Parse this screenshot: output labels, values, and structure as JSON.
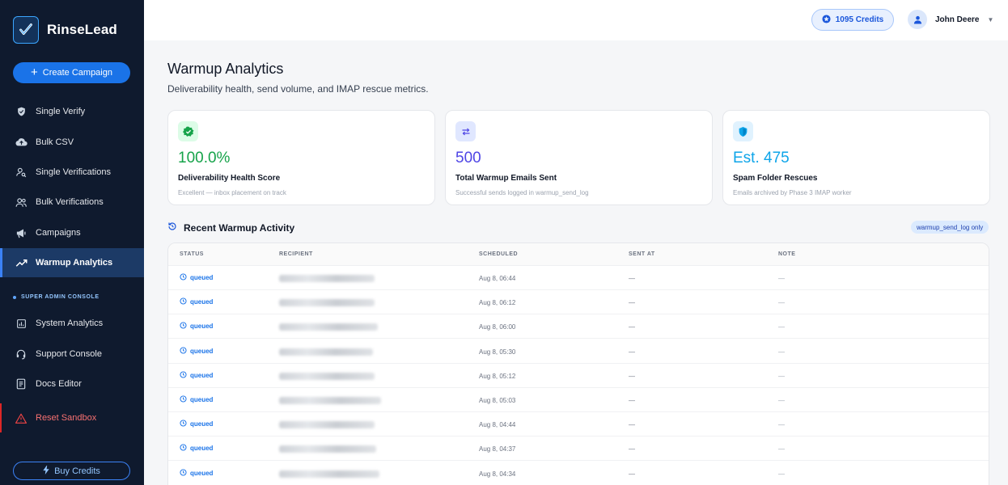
{
  "brand": {
    "name": "RinseLead"
  },
  "sidebar": {
    "create_label": "Create Campaign",
    "items": [
      {
        "label": "Single Verify",
        "icon": "shield-icon"
      },
      {
        "label": "Bulk CSV",
        "icon": "cloud-upload-icon"
      },
      {
        "label": "Single Verifications",
        "icon": "person-search-icon"
      },
      {
        "label": "Bulk Verifications",
        "icon": "group-icon"
      },
      {
        "label": "Campaigns",
        "icon": "megaphone-icon"
      },
      {
        "label": "Warmup Analytics",
        "icon": "trending-up-icon",
        "active": true
      }
    ],
    "section_label": "SUPER ADMIN CONSOLE",
    "admin_items": [
      {
        "label": "System Analytics",
        "icon": "bar-chart-icon"
      },
      {
        "label": "Support Console",
        "icon": "headset-icon"
      },
      {
        "label": "Docs Editor",
        "icon": "document-icon"
      }
    ],
    "reset_label": "Reset Sandbox",
    "buy_label": "Buy Credits"
  },
  "topbar": {
    "credits": "1095 Credits",
    "user_name": "John Deere"
  },
  "page": {
    "title": "Warmup Analytics",
    "subtitle": "Deliverability health, send volume, and IMAP rescue metrics."
  },
  "metrics": [
    {
      "value": "100.0%",
      "label": "Deliverability Health Score",
      "hint": "Excellent — inbox placement on track",
      "icon": "check-badge-icon",
      "color": "#16a34a"
    },
    {
      "value": "500",
      "label": "Total Warmup Emails Sent",
      "hint": "Successful sends logged in warmup_send_log",
      "icon": "swap-arrows-icon",
      "color": "#4f46e5"
    },
    {
      "value": "Est. 475",
      "label": "Spam Folder Rescues",
      "hint": "Emails archived by Phase 3 IMAP worker",
      "icon": "shield-check-icon",
      "color": "#0ea5e9"
    }
  ],
  "activity": {
    "title": "Recent Warmup Activity",
    "badge": "warmup_send_log only",
    "columns": [
      "STATUS",
      "RECIPIENT",
      "SCHEDULED",
      "SENT AT",
      "NOTE"
    ],
    "rows": [
      {
        "status": "queued",
        "scheduled": "Aug 8, 06:44",
        "sent_at": "—",
        "note": "—"
      },
      {
        "status": "queued",
        "scheduled": "Aug 8, 06:12",
        "sent_at": "—",
        "note": "—"
      },
      {
        "status": "queued",
        "scheduled": "Aug 8, 06:00",
        "sent_at": "—",
        "note": "—"
      },
      {
        "status": "queued",
        "scheduled": "Aug 8, 05:30",
        "sent_at": "—",
        "note": "—"
      },
      {
        "status": "queued",
        "scheduled": "Aug 8, 05:12",
        "sent_at": "—",
        "note": "—"
      },
      {
        "status": "queued",
        "scheduled": "Aug 8, 05:03",
        "sent_at": "—",
        "note": "—"
      },
      {
        "status": "queued",
        "scheduled": "Aug 8, 04:44",
        "sent_at": "—",
        "note": "—"
      },
      {
        "status": "queued",
        "scheduled": "Aug 8, 04:37",
        "sent_at": "—",
        "note": "—"
      },
      {
        "status": "queued",
        "scheduled": "Aug 8, 04:34",
        "sent_at": "—",
        "note": "—"
      }
    ]
  },
  "colors": {
    "sidebar_bg": "#0f1a2e",
    "accent": "#1a73e8",
    "danger": "#dc2626"
  }
}
